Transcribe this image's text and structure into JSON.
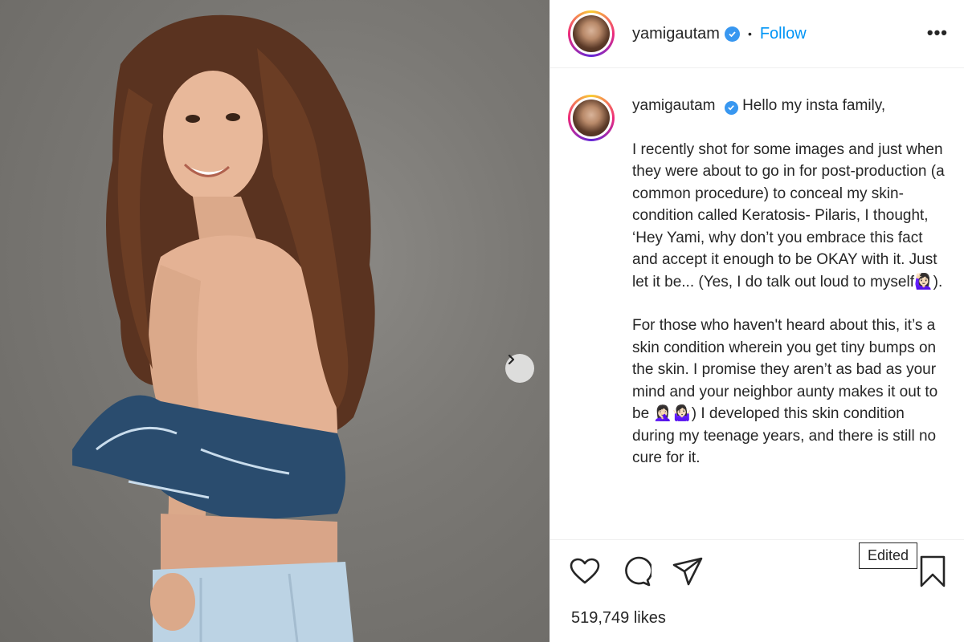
{
  "header": {
    "username": "yamigautam",
    "separator": "•",
    "follow_label": "Follow",
    "more_label": "•••"
  },
  "caption": {
    "username": "yamigautam",
    "paragraphs": [
      "Hello my insta family,",
      "I recently shot for some images and just when they were about to go in for post-production (a common procedure) to conceal my skin-condition called Keratosis- Pilaris, I thought, ‘Hey Yami, why don’t you embrace this fact and accept it enough to be OKAY with it. Just let it be... (Yes, I do talk out loud to myself🙋🏻‍♀️).",
      "For those who haven't heard about this, it’s a skin condition wherein you get tiny bumps on the skin. I promise they aren’t as bad as your mind and your neighbor aunty makes it out to be 🤦🏻‍♀️🤷🏻‍♀️) I developed this skin condition during my teenage years, and there is still no cure for it."
    ]
  },
  "actions": {
    "like_icon": "heart-icon",
    "comment_icon": "comment-icon",
    "share_icon": "paper-plane-icon",
    "save_icon": "bookmark-icon",
    "tooltip": "Edited"
  },
  "stats": {
    "likes": "519,749 likes"
  },
  "colors": {
    "accent": "#0095f6",
    "verified": "#3897f0",
    "text": "#262626"
  }
}
